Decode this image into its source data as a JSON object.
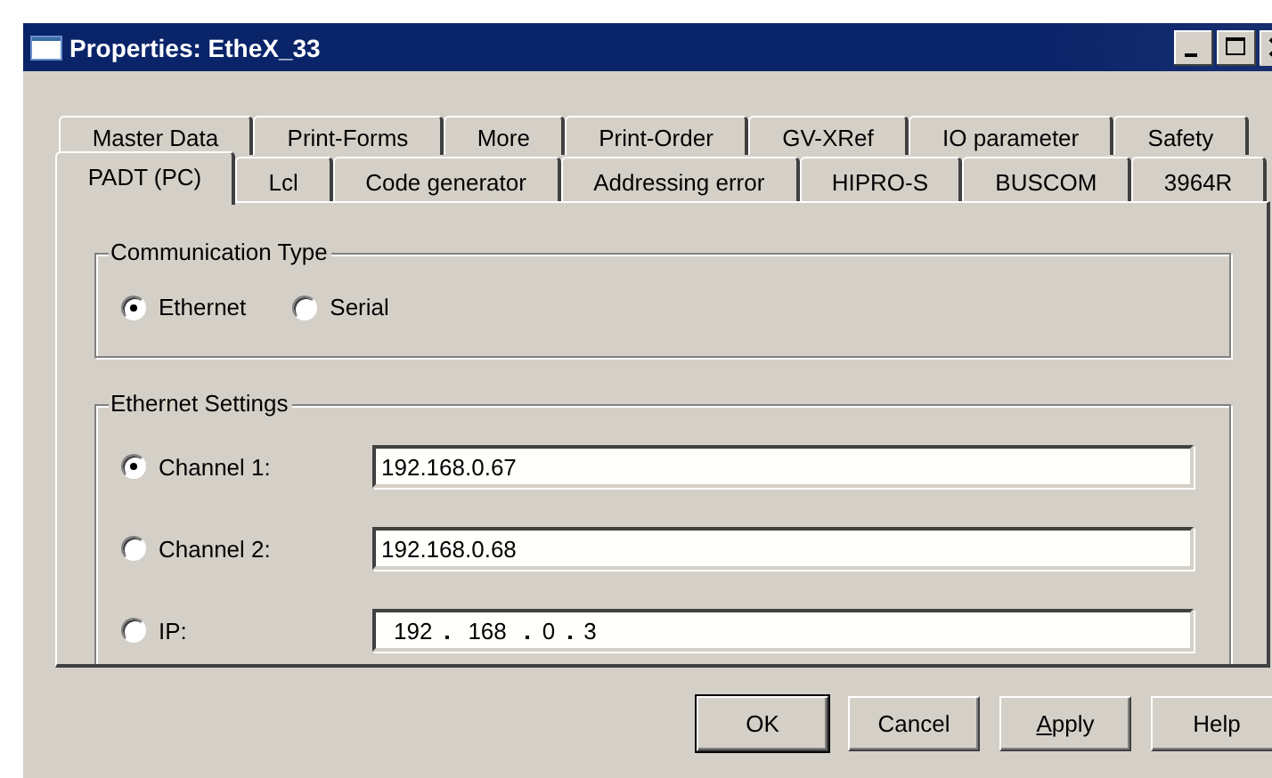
{
  "window": {
    "title": "Properties: EtheX_33"
  },
  "tab_rows": [
    [
      {
        "label": "Master Data",
        "selected": false
      },
      {
        "label": "Print-Forms",
        "selected": false
      },
      {
        "label": "More",
        "selected": false
      },
      {
        "label": "Print-Order",
        "selected": false
      },
      {
        "label": "GV-XRef",
        "selected": false
      },
      {
        "label": "IO parameter",
        "selected": false
      },
      {
        "label": "Safety",
        "selected": false
      }
    ],
    [
      {
        "label": "PADT (PC)",
        "selected": true
      },
      {
        "label": "Lcl",
        "selected": false
      },
      {
        "label": "Code generator",
        "selected": false
      },
      {
        "label": "Addressing error",
        "selected": false
      },
      {
        "label": "HIPRO-S",
        "selected": false
      },
      {
        "label": "BUSCOM",
        "selected": false
      },
      {
        "label": "3964R",
        "selected": false
      }
    ]
  ],
  "communication_type": {
    "label": "Communication Type",
    "options": [
      {
        "label": "Ethernet",
        "selected": true
      },
      {
        "label": "Serial",
        "selected": false
      }
    ]
  },
  "ethernet_settings": {
    "label": "Ethernet Settings",
    "rows": [
      {
        "kind": "text",
        "label": "Channel 1:",
        "selected": true,
        "value": "192.168.0.67"
      },
      {
        "kind": "text",
        "label": "Channel 2:",
        "selected": false,
        "value": "192.168.0.68"
      },
      {
        "kind": "ip",
        "label": "IP:",
        "selected": false,
        "octets": [
          "192",
          "168",
          "0",
          "3"
        ]
      }
    ]
  },
  "buttons": [
    {
      "label": "OK",
      "default": true,
      "mnemonic_first": false
    },
    {
      "label": "Cancel",
      "default": false,
      "mnemonic_first": false
    },
    {
      "label": "Apply",
      "default": false,
      "mnemonic_first": true
    },
    {
      "label": "Help",
      "default": false,
      "mnemonic_first": false
    }
  ]
}
